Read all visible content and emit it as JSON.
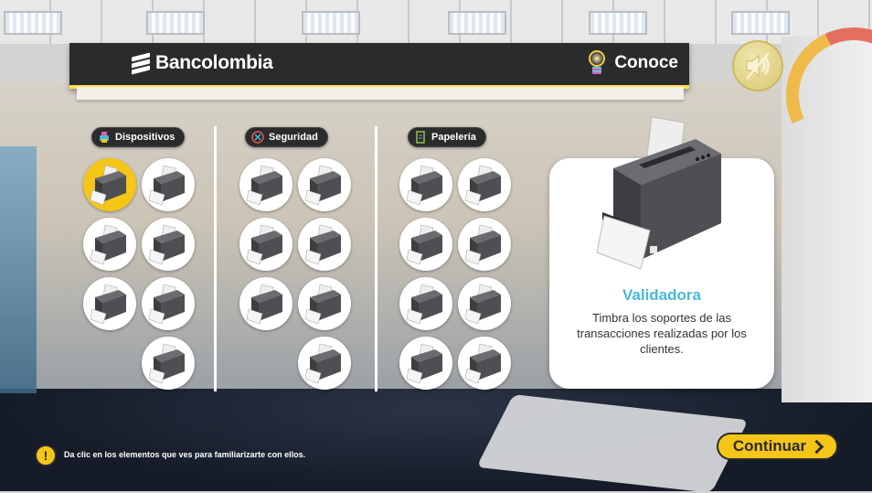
{
  "header": {
    "brand": "Bancolombia",
    "conoce_label": "Conoce"
  },
  "categories": [
    {
      "label": "Dispositivos",
      "icon": "printer-icon"
    },
    {
      "label": "Seguridad",
      "icon": "shield-icon"
    },
    {
      "label": "Papelería",
      "icon": "paper-stack-icon"
    }
  ],
  "items": {
    "dispositivos_count": 7,
    "seguridad_count": 7,
    "papeleria_count": 8,
    "active_item": "Validadora"
  },
  "detail": {
    "title": "Validadora",
    "description": "Timbra los soportes de las transacciones realizadas por los clientes."
  },
  "footer": {
    "hint": "Da clic en los elementos que ves para familiarizarte con ellos.",
    "continue_label": "Continuar"
  },
  "colors": {
    "accent_yellow": "#f5c518",
    "title_blue": "#4bb7dd",
    "banner_dark": "#2a2b2d"
  }
}
